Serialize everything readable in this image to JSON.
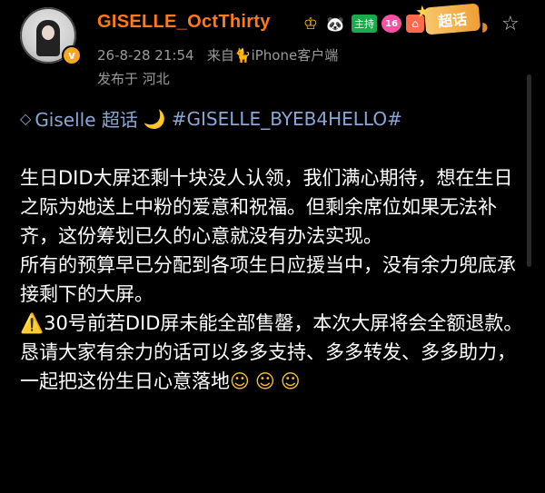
{
  "header": {
    "username": "GISELLE_OctThirty",
    "verified_icon": "v-badge-icon",
    "badges": {
      "crown": "♔",
      "panda": "🐼",
      "host": "主持",
      "level": "16",
      "shop": "⌂"
    },
    "supertopic_badge": "超话",
    "timestamp": "26-8-28 21:54",
    "source_prefix": "来自",
    "source": "iPhone客户端",
    "location": "发布于 河北"
  },
  "post": {
    "topic_name": "Giselle 超话",
    "moon": "🌙",
    "hashtag": "#GISELLE_BYEB4HELLO#",
    "paragraph1": "生日DID大屏还剩十块没人认领，我们满心期待，想在生日之际为她送上中粉的爱意和祝福。但剩余席位如果无法补齐，这份筹划已久的心意就没有办法实现。",
    "paragraph2": "所有的预算早已分配到各项生日应援当中，没有余力兜底承接剩下的大屏。",
    "warning_icon": "⚠️",
    "paragraph3": "30号前若DID屏未能全部售罄，本次大屏将会全额退款。",
    "paragraph4": "恳请大家有余力的话可以多多支持、多多转发、多多助力，一起把这份生日心意落地",
    "smiles": "☺☺☺"
  },
  "colors": {
    "username": "#ff7a1a",
    "topic": "#8aa7d6",
    "meta": "#9a9a9a",
    "host_badge": "#1aa94b"
  }
}
